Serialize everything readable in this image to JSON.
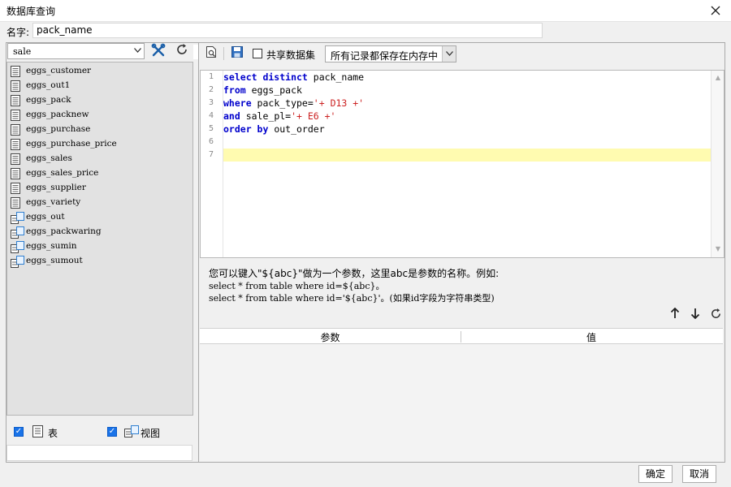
{
  "window": {
    "title": "数据库查询"
  },
  "name_field": {
    "label": "名字:",
    "value": "pack_name"
  },
  "left": {
    "datasource": "sale",
    "tables": [
      {
        "label": "eggs_customer",
        "type": "table"
      },
      {
        "label": "eggs_out1",
        "type": "table"
      },
      {
        "label": "eggs_pack",
        "type": "table"
      },
      {
        "label": "eggs_packnew",
        "type": "table"
      },
      {
        "label": "eggs_purchase",
        "type": "table"
      },
      {
        "label": "eggs_purchase_price",
        "type": "table"
      },
      {
        "label": "eggs_sales",
        "type": "table"
      },
      {
        "label": "eggs_sales_price",
        "type": "table"
      },
      {
        "label": "eggs_supplier",
        "type": "table"
      },
      {
        "label": "eggs_variety",
        "type": "table"
      },
      {
        "label": "eggs_out",
        "type": "view"
      },
      {
        "label": "eggs_packwaring",
        "type": "view"
      },
      {
        "label": "eggs_sumin",
        "type": "view"
      },
      {
        "label": "eggs_sumout",
        "type": "view"
      }
    ],
    "filter_table_label": "表",
    "filter_view_label": "视图"
  },
  "toolbar": {
    "share_label": "共享数据集",
    "mode_value": "所有记录都保存在内存中"
  },
  "editor": {
    "line_numbers": [
      "1",
      "2",
      "3",
      "4",
      "5",
      "6",
      "7"
    ],
    "lines": [
      [
        {
          "t": "select distinct",
          "c": "kw"
        },
        {
          "t": " pack_name",
          "c": ""
        }
      ],
      [
        {
          "t": "from",
          "c": "kw"
        },
        {
          "t": " eggs_pack",
          "c": ""
        }
      ],
      [
        {
          "t": "where",
          "c": "kw"
        },
        {
          "t": " pack_type=",
          "c": ""
        },
        {
          "t": "'+ D13 +'",
          "c": "str"
        }
      ],
      [
        {
          "t": "and",
          "c": "kw"
        },
        {
          "t": " sale_pl=",
          "c": ""
        },
        {
          "t": "'+ E6 +'",
          "c": "str"
        }
      ],
      [
        {
          "t": "order by",
          "c": "kw"
        },
        {
          "t": " out_order",
          "c": ""
        }
      ],
      [],
      []
    ]
  },
  "hint": {
    "line1": "您可以键入\"${abc}\"做为一个参数，这里abc是参数的名称。例如:",
    "line2": "select * from table where id=${abc}。",
    "line3": "select * from table where id='${abc}'。(如果id字段为字符串类型)"
  },
  "params": {
    "col_param": "参数",
    "col_value": "值"
  },
  "buttons": {
    "ok": "确定",
    "cancel": "取消"
  }
}
